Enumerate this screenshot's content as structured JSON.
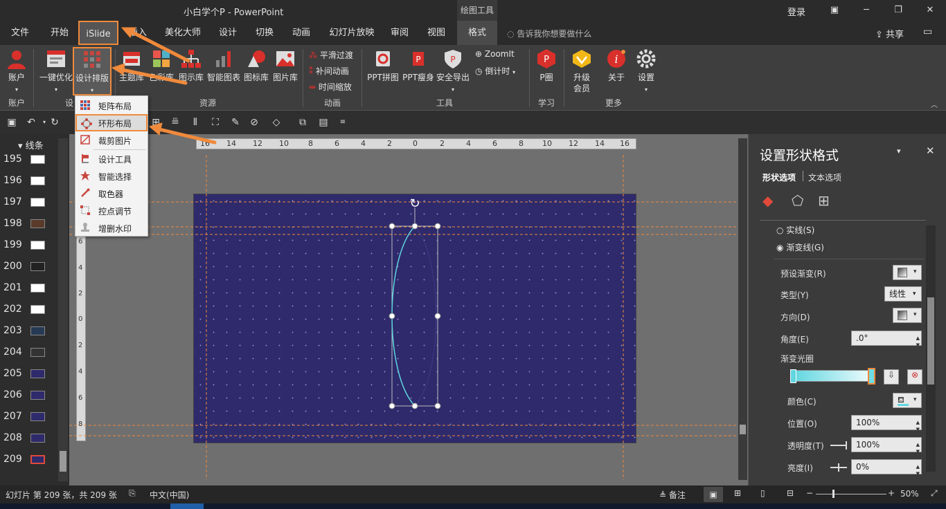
{
  "title": {
    "app_title": "小白学个P  -  PowerPoint",
    "context_tab": "绘图工具",
    "login": "登录"
  },
  "tabs": [
    "文件",
    "开始",
    "iSlide",
    "插入",
    "美化大师",
    "设计",
    "切换",
    "动画",
    "幻灯片放映",
    "审阅",
    "视图",
    "格式"
  ],
  "tell_me": "告诉我你想要做什么",
  "share": "共享",
  "ribbon": {
    "buttons": {
      "account": "账户",
      "one_click": "一键优化",
      "design_layout": "设计排版",
      "theme_lib": "主题库",
      "color_lib": "色彩库",
      "diagram_lib": "图示库",
      "smart_chart": "智能图表",
      "icon_lib": "图标库",
      "image_lib": "图片库",
      "smooth_transition": "平滑过渡",
      "tween_anim": "补间动画",
      "time_zoom": "时间缩放",
      "ppt_collage": "PPT拼图",
      "ppt_slim": "PPT瘦身",
      "safe_export": "安全导出",
      "zoomit": "ZoomIt",
      "countdown": "倒计时",
      "p_circle": "P圈",
      "upgrade": "升级会员",
      "about": "关于",
      "settings": "设置"
    },
    "groups": {
      "account": "账户",
      "design": "设",
      "resources": "资源",
      "animation": "动画",
      "tools": "工具",
      "learn": "学习",
      "more": "更多"
    }
  },
  "dropdown": {
    "items": [
      "矩阵布局",
      "环形布局",
      "裁剪图片",
      "设计工具",
      "智能选择",
      "取色器",
      "控点调节",
      "增删水印"
    ]
  },
  "thumbs": {
    "header": "线条",
    "numbers": [
      "195",
      "196",
      "197",
      "198",
      "199",
      "200",
      "201",
      "202",
      "203",
      "204",
      "205",
      "206",
      "207",
      "208",
      "209"
    ]
  },
  "ruler": {
    "h_labels": [
      "16",
      "14",
      "12",
      "10",
      "8",
      "6",
      "4",
      "2",
      "0",
      "2",
      "4",
      "6",
      "8",
      "10",
      "12",
      "14",
      "16"
    ],
    "v_labels": [
      "6",
      "4",
      "2",
      "0",
      "2",
      "4",
      "6",
      "8"
    ]
  },
  "pane": {
    "title": "设置形状格式",
    "tab_shape": "形状选项",
    "tab_text": "文本选项",
    "solid_line": "实线(S)",
    "gradient_line": "渐变线(G)",
    "preset_gradient": "预设渐变(R)",
    "type_label": "类型(Y)",
    "type_value": "线性",
    "direction": "方向(D)",
    "angle": "角度(E)",
    "angle_value": ".0°",
    "gradient_stops": "渐变光圈",
    "color": "颜色(C)",
    "position": "位置(O)",
    "position_value": "100%",
    "transparency": "透明度(T)",
    "transparency_value": "100%",
    "brightness": "亮度(I)",
    "brightness_value": "0%"
  },
  "status": {
    "slide_info": "幻灯片 第 209 张，共 209 张",
    "language": "中文(中国)",
    "notes": "备注",
    "zoom": "50%"
  },
  "colors": {
    "accent_orange": "#f08a3c",
    "slide_bg": "#2e2a6b",
    "gradient_start": "#5fd6e0",
    "gradient_end": "#f0fbfc"
  }
}
